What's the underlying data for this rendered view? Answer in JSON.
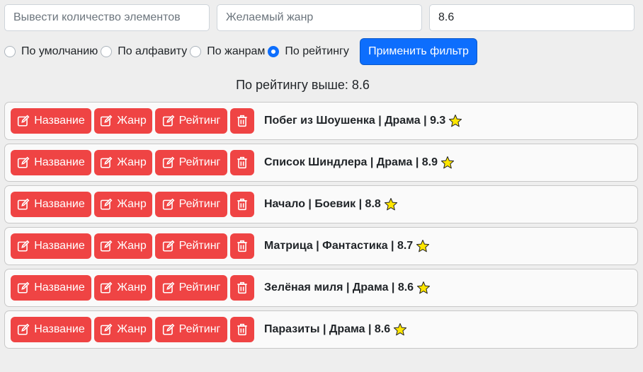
{
  "filters": {
    "count_placeholder": "Вывести количество элементов",
    "genre_placeholder": "Желаемый жанр",
    "rating_value": "8.6"
  },
  "sort_options": [
    {
      "label": "По умолчанию",
      "checked": false
    },
    {
      "label": "По алфавиту",
      "checked": false
    },
    {
      "label": "По жанрам",
      "checked": false
    },
    {
      "label": "По рейтингу",
      "checked": true
    }
  ],
  "apply_button_label": "Применить фильтр",
  "heading": "По рейтингу выше: 8.6",
  "buttons": {
    "name_label": "Название",
    "genre_label": "Жанр",
    "rating_label": "Рейтинг"
  },
  "movies": [
    {
      "text": "Побег из Шоушенка | Драма | 9.3"
    },
    {
      "text": "Список Шиндлера | Драма | 8.9"
    },
    {
      "text": "Начало | Боевик | 8.8"
    },
    {
      "text": "Матрица | Фантастика | 8.7"
    },
    {
      "text": "Зелёная миля | Драма | 8.6"
    },
    {
      "text": "Паразиты | Драма | 8.6"
    }
  ],
  "colors": {
    "accent_blue": "#0d6efd",
    "danger_red": "#ef4444",
    "star_yellow": "#ffe600"
  },
  "icons": {
    "edit": "edit-icon",
    "delete": "trash-icon",
    "rating": "star-icon"
  }
}
